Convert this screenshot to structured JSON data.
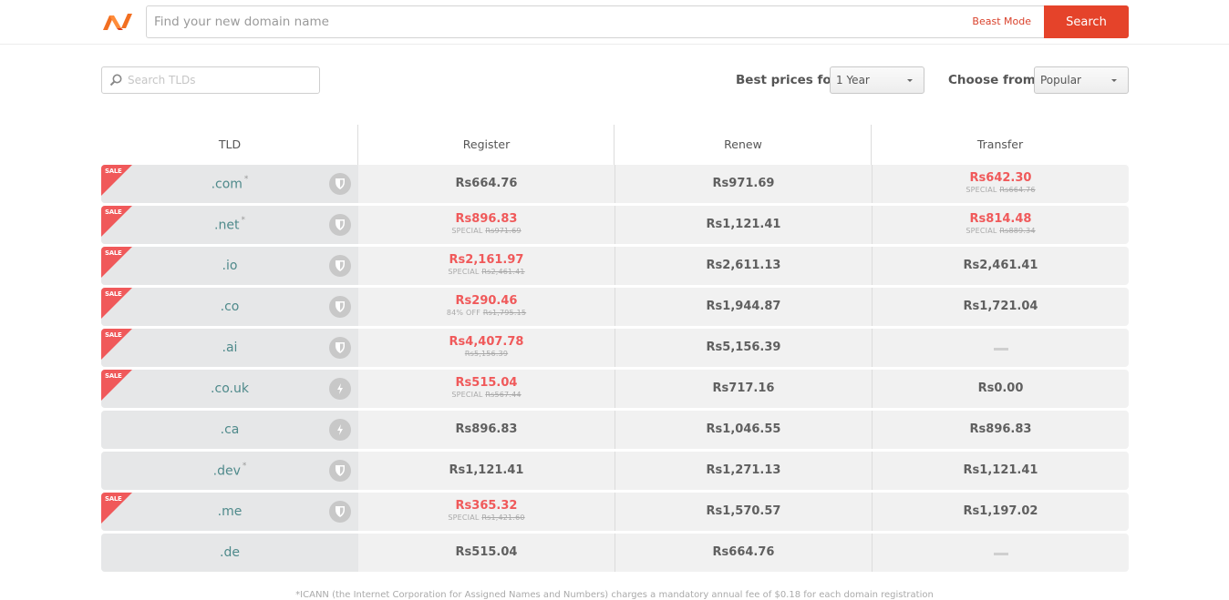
{
  "header": {
    "logo": "namecheap-logo",
    "search_placeholder": "Find your new domain name",
    "beast_mode": "Beast Mode",
    "search_button": "Search"
  },
  "filters": {
    "tld_search_placeholder": "Search TLDs",
    "best_prices_label": "Best prices for",
    "best_prices_value": "1 Year",
    "choose_from_label": "Choose from",
    "choose_from_value": "Popular"
  },
  "table": {
    "columns": [
      "TLD",
      "Register",
      "Renew",
      "Transfer"
    ],
    "sale_label": "SALE",
    "rows": [
      {
        "tld": ".com",
        "asterisk": "*",
        "sale": true,
        "icon": "shield-icon",
        "register": {
          "price": "Rs664.76"
        },
        "renew": {
          "price": "Rs971.69"
        },
        "transfer": {
          "price": "Rs642.30",
          "note": "SPECIAL",
          "old": "Rs664.76"
        }
      },
      {
        "tld": ".net",
        "asterisk": "*",
        "sale": true,
        "icon": "shield-icon",
        "register": {
          "price": "Rs896.83",
          "note": "SPECIAL",
          "old": "Rs971.69"
        },
        "renew": {
          "price": "Rs1,121.41"
        },
        "transfer": {
          "price": "Rs814.48",
          "note": "SPECIAL",
          "old": "Rs889.34"
        }
      },
      {
        "tld": ".io",
        "asterisk": "",
        "sale": true,
        "icon": "shield-icon",
        "register": {
          "price": "Rs2,161.97",
          "note": "SPECIAL",
          "old": "Rs2,461.41"
        },
        "renew": {
          "price": "Rs2,611.13"
        },
        "transfer": {
          "price": "Rs2,461.41"
        }
      },
      {
        "tld": ".co",
        "asterisk": "",
        "sale": true,
        "icon": "shield-icon",
        "register": {
          "price": "Rs290.46",
          "note": "84% OFF",
          "old": "Rs1,795.15"
        },
        "renew": {
          "price": "Rs1,944.87"
        },
        "transfer": {
          "price": "Rs1,721.04"
        }
      },
      {
        "tld": ".ai",
        "asterisk": "",
        "sale": true,
        "icon": "shield-icon",
        "register": {
          "price": "Rs4,407.78",
          "note": "",
          "old": "Rs5,156.39"
        },
        "renew": {
          "price": "Rs5,156.39"
        },
        "transfer": {
          "price": null
        }
      },
      {
        "tld": ".co.uk",
        "asterisk": "",
        "sale": true,
        "icon": "lightning-icon",
        "register": {
          "price": "Rs515.04",
          "note": "SPECIAL",
          "old": "Rs567.44"
        },
        "renew": {
          "price": "Rs717.16"
        },
        "transfer": {
          "price": "Rs0.00"
        }
      },
      {
        "tld": ".ca",
        "asterisk": "",
        "sale": false,
        "icon": "lightning-icon",
        "register": {
          "price": "Rs896.83"
        },
        "renew": {
          "price": "Rs1,046.55"
        },
        "transfer": {
          "price": "Rs896.83"
        }
      },
      {
        "tld": ".dev",
        "asterisk": "*",
        "sale": false,
        "icon": "shield-icon",
        "register": {
          "price": "Rs1,121.41"
        },
        "renew": {
          "price": "Rs1,271.13"
        },
        "transfer": {
          "price": "Rs1,121.41"
        }
      },
      {
        "tld": ".me",
        "asterisk": "",
        "sale": true,
        "icon": "shield-icon",
        "register": {
          "price": "Rs365.32",
          "note": "SPECIAL",
          "old": "Rs1,421.60"
        },
        "renew": {
          "price": "Rs1,570.57"
        },
        "transfer": {
          "price": "Rs1,197.02"
        }
      },
      {
        "tld": ".de",
        "asterisk": "",
        "sale": false,
        "icon": null,
        "register": {
          "price": "Rs515.04"
        },
        "renew": {
          "price": "Rs664.76"
        },
        "transfer": {
          "price": null
        }
      }
    ]
  },
  "footnote": "*ICANN (the Internet Corporation for Assigned Names and Numbers) charges a mandatory annual fee of $0.18 for each domain registration"
}
